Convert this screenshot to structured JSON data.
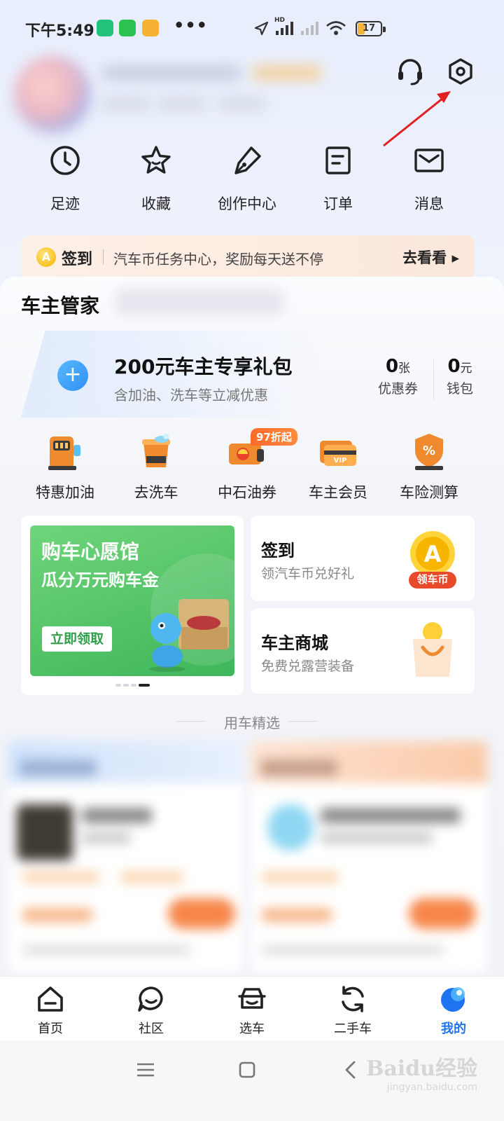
{
  "status_bar": {
    "time": "下午5:49",
    "dots": "•••",
    "signal_label": "HD",
    "battery": "17"
  },
  "shortcuts": [
    {
      "label": "足迹",
      "icon": "clock-icon"
    },
    {
      "label": "收藏",
      "icon": "star-icon"
    },
    {
      "label": "创作中心",
      "icon": "pen-icon"
    },
    {
      "label": "订单",
      "icon": "order-icon"
    },
    {
      "label": "消息",
      "icon": "mail-icon"
    }
  ],
  "signin_banner": {
    "badge": "A",
    "title": "签到",
    "desc": "汽车币任务中心，奖励每天送不停",
    "go": "去看看 ▸"
  },
  "owner_section": {
    "title": "车主管家",
    "gift_title": "200元车主专享礼包",
    "gift_sub": "含加油、洗车等立减优惠",
    "plus": "+",
    "coupons": {
      "num": "0",
      "unit": "张",
      "label": "优惠券"
    },
    "wallet": {
      "num": "0",
      "unit": "元",
      "label": "钱包"
    }
  },
  "services": [
    {
      "label": "特惠加油",
      "icon": "fuel-pump-icon"
    },
    {
      "label": "去洗车",
      "icon": "car-wash-bucket-icon"
    },
    {
      "label": "中石油券",
      "icon": "petrochina-coupon-icon",
      "tag": "97折起"
    },
    {
      "label": "车主会员",
      "icon": "vip-card-icon"
    },
    {
      "label": "车险测算",
      "icon": "insurance-shield-icon"
    }
  ],
  "wish_card": {
    "title": "购车心愿馆",
    "sub": "瓜分万元购车金",
    "button": "立即领取"
  },
  "side_cards": [
    {
      "title": "签到",
      "sub": "领汽车币兑好礼",
      "badge": "领车币",
      "icon": "coin-icon"
    },
    {
      "title": "车主商城",
      "sub": "免费兑露营装备",
      "icon": "shopping-bag-icon"
    }
  ],
  "feed_title": "用车精选",
  "tabbar": [
    {
      "label": "首页",
      "icon": "home-icon",
      "active": false
    },
    {
      "label": "社区",
      "icon": "community-icon",
      "active": false
    },
    {
      "label": "选车",
      "icon": "car-select-icon",
      "active": false
    },
    {
      "label": "二手车",
      "icon": "used-car-icon",
      "active": false
    },
    {
      "label": "我的",
      "icon": "profile-icon",
      "active": true
    }
  ],
  "watermark": {
    "logo": "Baidu经验",
    "url": "jingyan.baidu.com"
  },
  "colors": {
    "accent": "#1f73f0",
    "green": "#3fb65a",
    "orange": "#ff6a2a",
    "arrow": "#e02020"
  }
}
